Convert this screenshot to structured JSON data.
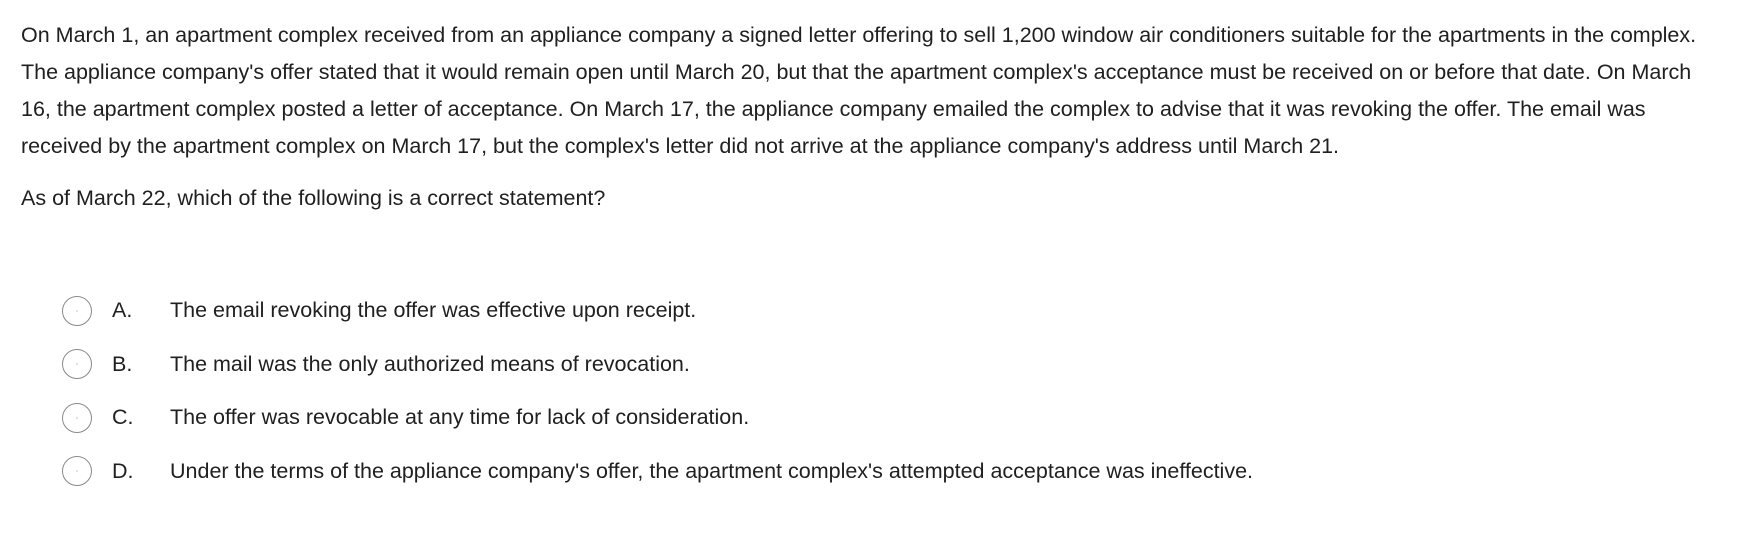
{
  "question": {
    "passage": "On March 1, an apartment complex received from an appliance company a signed letter offering to sell 1,200 window air conditioners suitable for the apartments in the complex.  The appliance company's offer stated that it would remain open until March 20, but that the apartment complex's acceptance must be received on or before that date.  On March 16, the apartment complex posted a letter of acceptance.  On March 17, the appliance company emailed the complex to advise that it was revoking the offer.  The email was received by the apartment complex on March 17, but the complex's letter did not arrive at the appliance company's address until March 21.",
    "prompt": "As of March 22, which of the following is a correct statement?"
  },
  "choices": [
    {
      "letter": "A.",
      "text": "The email revoking the offer was effective upon receipt."
    },
    {
      "letter": "B.",
      "text": "The mail was the only authorized means of revocation."
    },
    {
      "letter": "C.",
      "text": "The offer was revocable at any time for lack of consideration."
    },
    {
      "letter": "D.",
      "text": "Under the terms of the appliance company's offer, the apartment complex's attempted acceptance was ineffective."
    }
  ]
}
